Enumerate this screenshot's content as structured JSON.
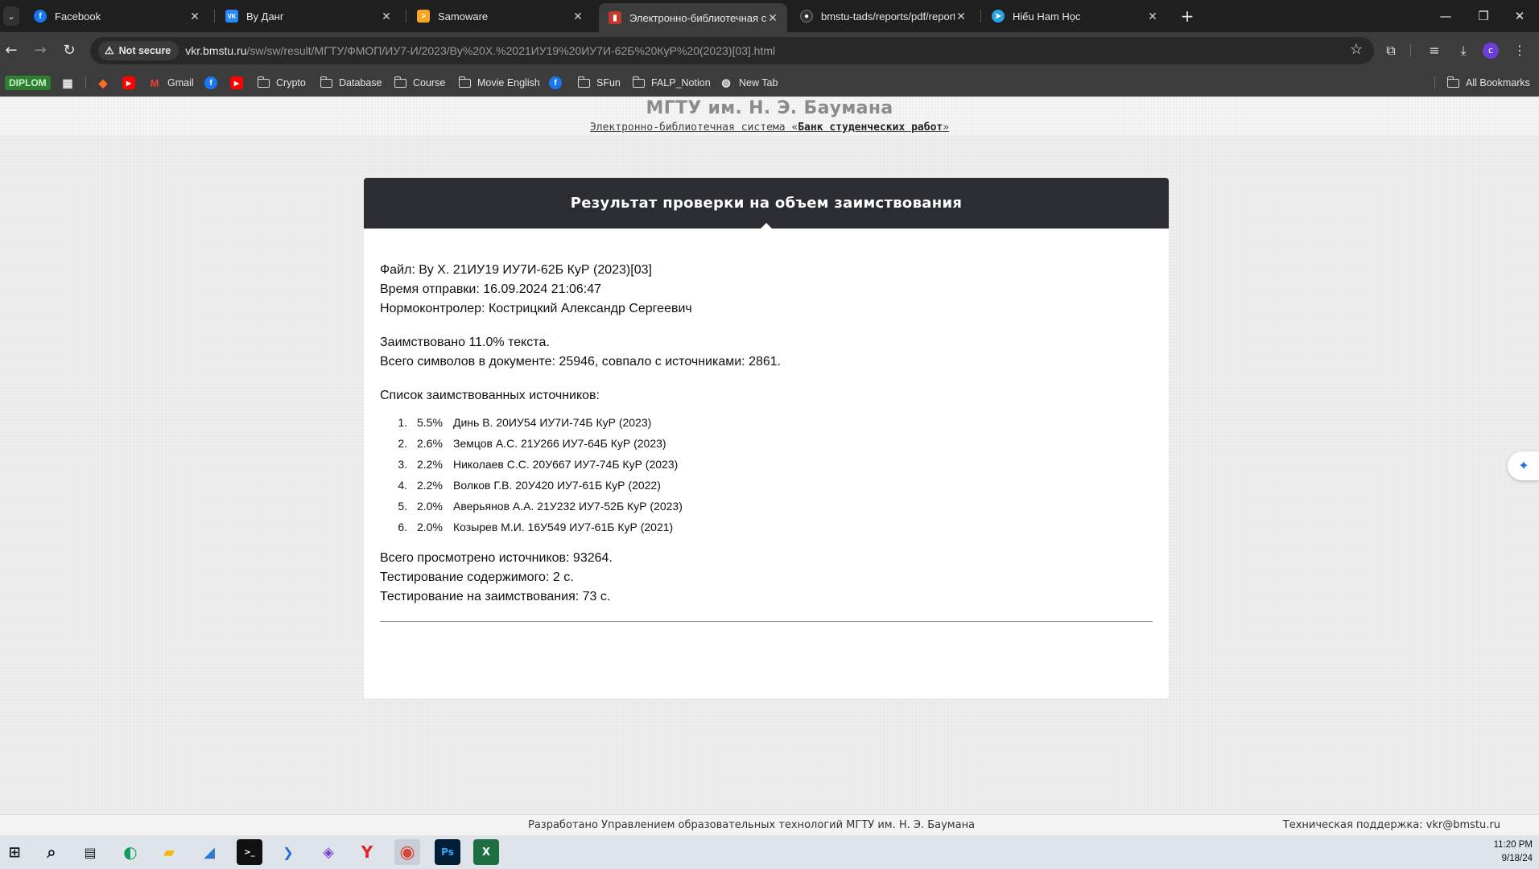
{
  "tabs": [
    {
      "title": "Facebook",
      "favicon": "facebook-icon",
      "color": "#1877f2"
    },
    {
      "title": "Ву Данг",
      "favicon": "vk-icon",
      "color": "#2787f5"
    },
    {
      "title": "Samoware",
      "favicon": "samoware-icon",
      "color": "#f5a623"
    },
    {
      "title": "Электронно-библиотечная си",
      "favicon": "library-icon",
      "color": "#c0392b"
    },
    {
      "title": "bmstu-tads/reports/pdf/report_",
      "favicon": "github-icon",
      "color": "#333333"
    },
    {
      "title": "Hiếu Ham Học",
      "favicon": "telegram-icon",
      "color": "#2aa3e0"
    }
  ],
  "address": {
    "security_label": "Not secure",
    "host": "vkr.bmstu.ru",
    "path": "/sw/sw/result/МГТУ/ФМОП/ИУ7-И/2023/Ву%20Х.%2021ИУ19%20ИУ7И-62Б%20КуР%20(2023)[03].html"
  },
  "profile_initial": "c",
  "bookmarks": [
    {
      "label": "DIPLOM",
      "type": "badge"
    },
    {
      "label": "",
      "type": "apps"
    },
    {
      "label": "",
      "type": "gitlab"
    },
    {
      "label": "",
      "type": "youtube"
    },
    {
      "label": "Gmail",
      "type": "gmail"
    },
    {
      "label": "",
      "type": "facebook"
    },
    {
      "label": "",
      "type": "youtube"
    },
    {
      "label": "Crypto",
      "type": "folder"
    },
    {
      "label": "Database",
      "type": "folder"
    },
    {
      "label": "Course",
      "type": "folder"
    },
    {
      "label": "Movie English",
      "type": "folder"
    },
    {
      "label": "",
      "type": "facebook"
    },
    {
      "label": "SFun",
      "type": "folder"
    },
    {
      "label": "FALP_Notion",
      "type": "folder"
    },
    {
      "label": "New Tab",
      "type": "globe"
    },
    {
      "label": "All Bookmarks",
      "type": "folder"
    }
  ],
  "site": {
    "title": "МГТУ им. Н. Э. Баумана",
    "subtitle_prefix": "Электронно-библиотечная система «",
    "subtitle_bold": "Банк студенческих работ",
    "subtitle_suffix": "»"
  },
  "result": {
    "heading": "Результат проверки на объем заимствования",
    "file": "Файл: Ву Х. 21ИУ19 ИУ7И-62Б КуР (2023)[03]",
    "sent_time": "Время отправки: 16.09.2024 21:06:47",
    "controller": "Нормоконтролер: Кострицкий Александр Сергеевич",
    "borrowed": "Заимствовано 11.0% текста.",
    "chars": "Всего символов в документе: 25946, совпало с источниками: 2861.",
    "sources_heading": "Список заимствованных источников:",
    "sources": [
      {
        "num": "1.",
        "pct": "5.5%",
        "name": "Динь В. 20ИУ54 ИУ7И-74Б КуР (2023)"
      },
      {
        "num": "2.",
        "pct": "2.6%",
        "name": "Земцов А.С. 21У266 ИУ7-64Б КуР (2023)"
      },
      {
        "num": "3.",
        "pct": "2.2%",
        "name": "Николаев С.С. 20У667 ИУ7-74Б КуР (2023)"
      },
      {
        "num": "4.",
        "pct": "2.2%",
        "name": "Волков Г.В. 20У420 ИУ7-61Б КуР (2022)"
      },
      {
        "num": "5.",
        "pct": "2.0%",
        "name": "Аверьянов А.А. 21У232 ИУ7-52Б КуР (2023)"
      },
      {
        "num": "6.",
        "pct": "2.0%",
        "name": "Козырев М.И. 16У549 ИУ7-61Б КуР (2021)"
      }
    ],
    "total_sources": "Всего просмотрено источников: 93264.",
    "content_test": "Тестирование содержимого: 2 с.",
    "borrow_test": "Тестирование на заимствования: 73 с."
  },
  "footer": {
    "developed": "Разработано Управлением образовательных технологий МГТУ им. Н. Э. Баумана",
    "support": "Техническая поддержка: vkr@bmstu.ru"
  },
  "taskbar": {
    "time": "11:20 PM",
    "date": "9/18/24"
  }
}
